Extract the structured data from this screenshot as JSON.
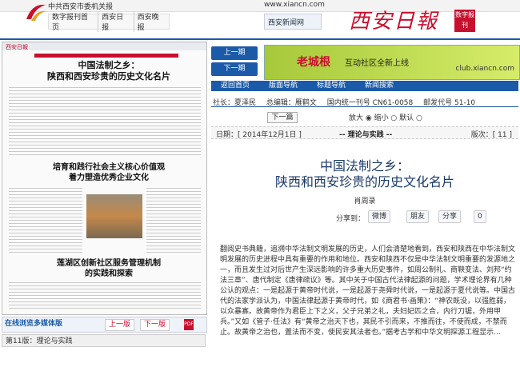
{
  "header": {
    "org": "中共西安市委机关报",
    "url": "www.xiancn.com",
    "nav_left": [
      "数字报刊首页",
      "西安日报",
      "西安晚报"
    ],
    "nav_right": [
      "西安新闻网"
    ],
    "brand": "西安日報",
    "badge": "数字报刊"
  },
  "paper": {
    "masthead": "西安日報",
    "headline1": "中国法制之乡：\n陕西和西安珍贵的历史文化名片",
    "headline2": "培育和践行社会主义核心价值观\n着力塑造优秀企业文化",
    "headline3": "莲湖区创新社区服务管理机制\n的实践和探索"
  },
  "bottom_bar": {
    "media": "在线浏览多媒体版",
    "prev": "上一版",
    "next": "下一版",
    "pdf": "PDF",
    "edition": "第11版：理论与实践"
  },
  "side": {
    "prev": "上一期",
    "next": "下一期"
  },
  "ad": {
    "brand": "老城根",
    "slogan": "互动社区全新上线",
    "domain": "club.xiancn.com"
  },
  "tabs": [
    "返回首页",
    "版面导航",
    "标题导航",
    "新闻搜索"
  ],
  "meta": {
    "president": "社长：夏泽民",
    "editor": "总编辑：雁鹤文",
    "issn": "国内统一刊号 CN61-0058",
    "post": "邮发代号 51-10"
  },
  "controls": {
    "prev_article": "下一篇",
    "zoom": "放大 ◉  缩小 ○  默认 ○"
  },
  "info": {
    "date": "日期：[ 2014年12月1日 ]",
    "column": "-- 理论与实践 --",
    "page": "版次：[ 11 ]"
  },
  "article": {
    "title": "中国法制之乡：\n陕西和西安珍贵的历史文化名片",
    "author": "肖周录",
    "share_label": "分享到：",
    "share": [
      "微博",
      "朋友",
      "分享",
      "0"
    ],
    "body": "翻阅史书典籍，追溯中华法制文明发展的历史，人们会清楚地看到，西安和陕西在中华法制文明发展的历史进程中具有重要的作用和地位。西安和陕西不仅是中华法制文明重要的发源地之一，而且发生过对后世产生深远影响的许多重大历史事件，如周公制礼、商鞅变法、刘邦“约法三章”、唐代制定《唐律疏议》等。其中关于中国古代法律起源的问题，学术理论界有几种公认的观点：一是起源于黄帝时代说，一是起源于尧舜时代说，一是起源于夏代说等。中国古代的法家学派认为，中国法律起源于黄帝时代，如《商君书·画策》：“神农既没，以强胜弱，以众暴寡。故黄帝作为君臣上下之义，父子兄弟之礼，夫妇妃匹之合，内行刀锯，外用甲兵。”又如《管子·任法》有“黄帝之治天下也，其民不引而来，不推而往，不使而成，不禁而止。故黄帝之治也，置法而不变，使民安其法者也。”据考古学和中华文明探源工程显示..."
  }
}
